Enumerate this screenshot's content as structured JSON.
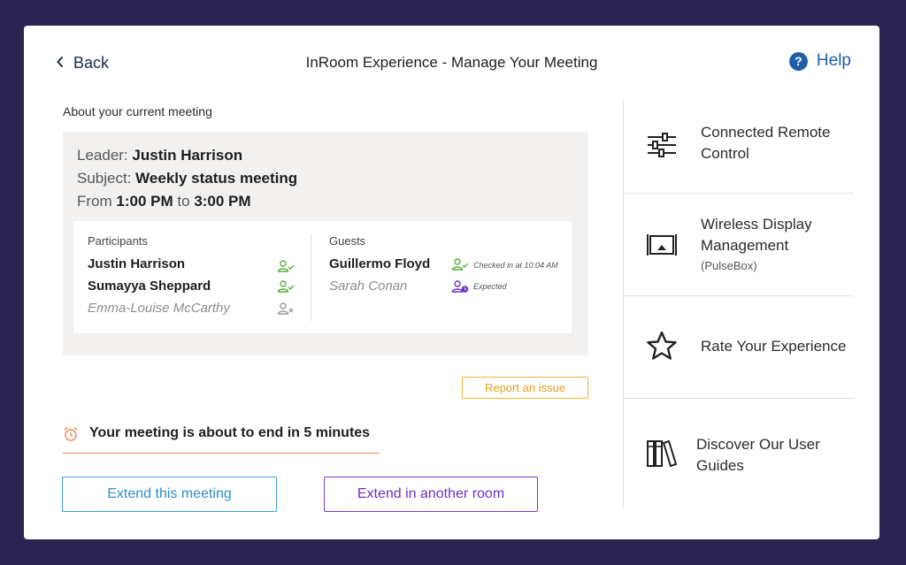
{
  "header": {
    "back_label": "Back",
    "title": "InRoom Experience - Manage Your Meeting",
    "help_label": "Help"
  },
  "meeting": {
    "section_label": "About your current meeting",
    "leader_label": "Leader:",
    "leader": "Justin Harrison",
    "subject_label": "Subject:",
    "subject": "Weekly status meeting",
    "from_label": "From",
    "start": "1:00 PM",
    "to_label": "to",
    "end": "3:00 PM"
  },
  "participants": {
    "heading": "Participants",
    "items": [
      {
        "name": "Justin Harrison",
        "status": "checked-in",
        "icon": "person-check-icon"
      },
      {
        "name": "Sumayya Sheppard",
        "status": "checked-in",
        "icon": "person-check-icon"
      },
      {
        "name": "Emma-Louise McCarthy",
        "status": "absent",
        "icon": "person-x-icon"
      }
    ]
  },
  "guests": {
    "heading": "Guests",
    "items": [
      {
        "name": "Guillermo Floyd",
        "status_text": "Checked in at 10:04 AM",
        "icon": "person-check-icon"
      },
      {
        "name": "Sarah Conan",
        "status_text": "Expected",
        "icon": "person-clock-icon"
      }
    ]
  },
  "actions": {
    "report_label": "Report an issue",
    "warning_message": "Your meeting is about to end in 5 minutes",
    "extend_label": "Extend this meeting",
    "extend_room_label": "Extend in another room"
  },
  "sidebar": {
    "items": [
      {
        "label_line1": "Connected Remote",
        "label_line2": "Control",
        "sub": "",
        "icon": "sliders-icon"
      },
      {
        "label_line1": "Wireless Display",
        "label_line2": "Management",
        "sub": "(PulseBox)",
        "icon": "display-icon"
      },
      {
        "label_line1": "Rate Your Experience",
        "label_line2": "",
        "sub": "",
        "icon": "star-icon"
      },
      {
        "label_line1": "Discover Our User",
        "label_line2": "Guides",
        "sub": "",
        "icon": "books-icon"
      }
    ]
  },
  "colors": {
    "background": "#2b2350",
    "help_blue": "#1f5fa8",
    "checked_green": "#5aad3f",
    "absent_gray": "#9a9a9a",
    "expected_purple": "#6b31c6",
    "report_orange": "#e6a020",
    "warning_orange": "#ef8a5a",
    "extend_blue": "#2f8fc8",
    "extend_room_purple": "#6b31c6"
  }
}
